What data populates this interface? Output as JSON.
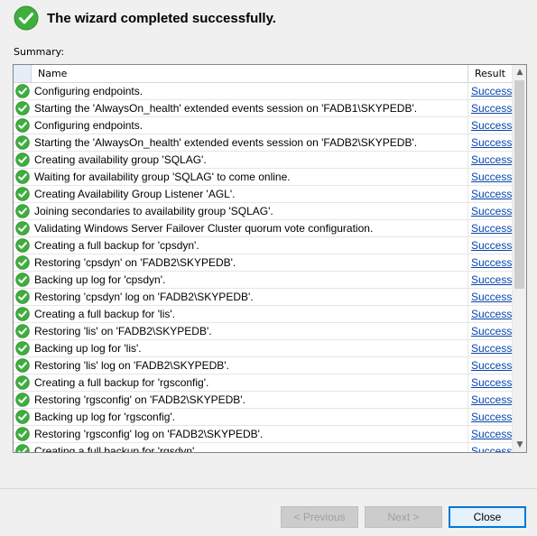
{
  "header": {
    "title": "The wizard completed successfully."
  },
  "summary_label": "Summary:",
  "table": {
    "columns": [
      "Name",
      "Result"
    ],
    "rows": [
      {
        "name": "Configuring endpoints.",
        "result": "Success"
      },
      {
        "name": "Starting the 'AlwaysOn_health' extended events session on 'FADB1\\SKYPEDB'.",
        "result": "Success"
      },
      {
        "name": "Configuring endpoints.",
        "result": "Success"
      },
      {
        "name": "Starting the 'AlwaysOn_health' extended events session on 'FADB2\\SKYPEDB'.",
        "result": "Success"
      },
      {
        "name": "Creating availability group 'SQLAG'.",
        "result": "Success"
      },
      {
        "name": "Waiting for availability group 'SQLAG' to come online.",
        "result": "Success"
      },
      {
        "name": "Creating Availability Group Listener 'AGL'.",
        "result": "Success"
      },
      {
        "name": "Joining secondaries to availability group 'SQLAG'.",
        "result": "Success"
      },
      {
        "name": "Validating Windows Server Failover Cluster quorum vote configuration.",
        "result": "Success"
      },
      {
        "name": "Creating a full backup for 'cpsdyn'.",
        "result": "Success"
      },
      {
        "name": "Restoring 'cpsdyn' on 'FADB2\\SKYPEDB'.",
        "result": "Success"
      },
      {
        "name": "Backing up log for 'cpsdyn'.",
        "result": "Success"
      },
      {
        "name": "Restoring 'cpsdyn' log on 'FADB2\\SKYPEDB'.",
        "result": "Success"
      },
      {
        "name": "Creating a full backup for 'lis'.",
        "result": "Success"
      },
      {
        "name": "Restoring 'lis' on 'FADB2\\SKYPEDB'.",
        "result": "Success"
      },
      {
        "name": "Backing up log for 'lis'.",
        "result": "Success"
      },
      {
        "name": "Restoring 'lis' log on 'FADB2\\SKYPEDB'.",
        "result": "Success"
      },
      {
        "name": "Creating a full backup for 'rgsconfig'.",
        "result": "Success"
      },
      {
        "name": "Restoring 'rgsconfig' on 'FADB2\\SKYPEDB'.",
        "result": "Success"
      },
      {
        "name": "Backing up log for 'rgsconfig'.",
        "result": "Success"
      },
      {
        "name": "Restoring 'rgsconfig' log on 'FADB2\\SKYPEDB'.",
        "result": "Success"
      },
      {
        "name": "Creating a full backup for 'rgsdyn'.",
        "result": "Success"
      }
    ]
  },
  "buttons": {
    "previous": "< Previous",
    "next": "Next >",
    "close": "Close"
  },
  "colors": {
    "success_green": "#3fae3f",
    "link": "#0645ad",
    "primary_border": "#0078d7"
  },
  "icons": {
    "status": "success-check-icon"
  }
}
